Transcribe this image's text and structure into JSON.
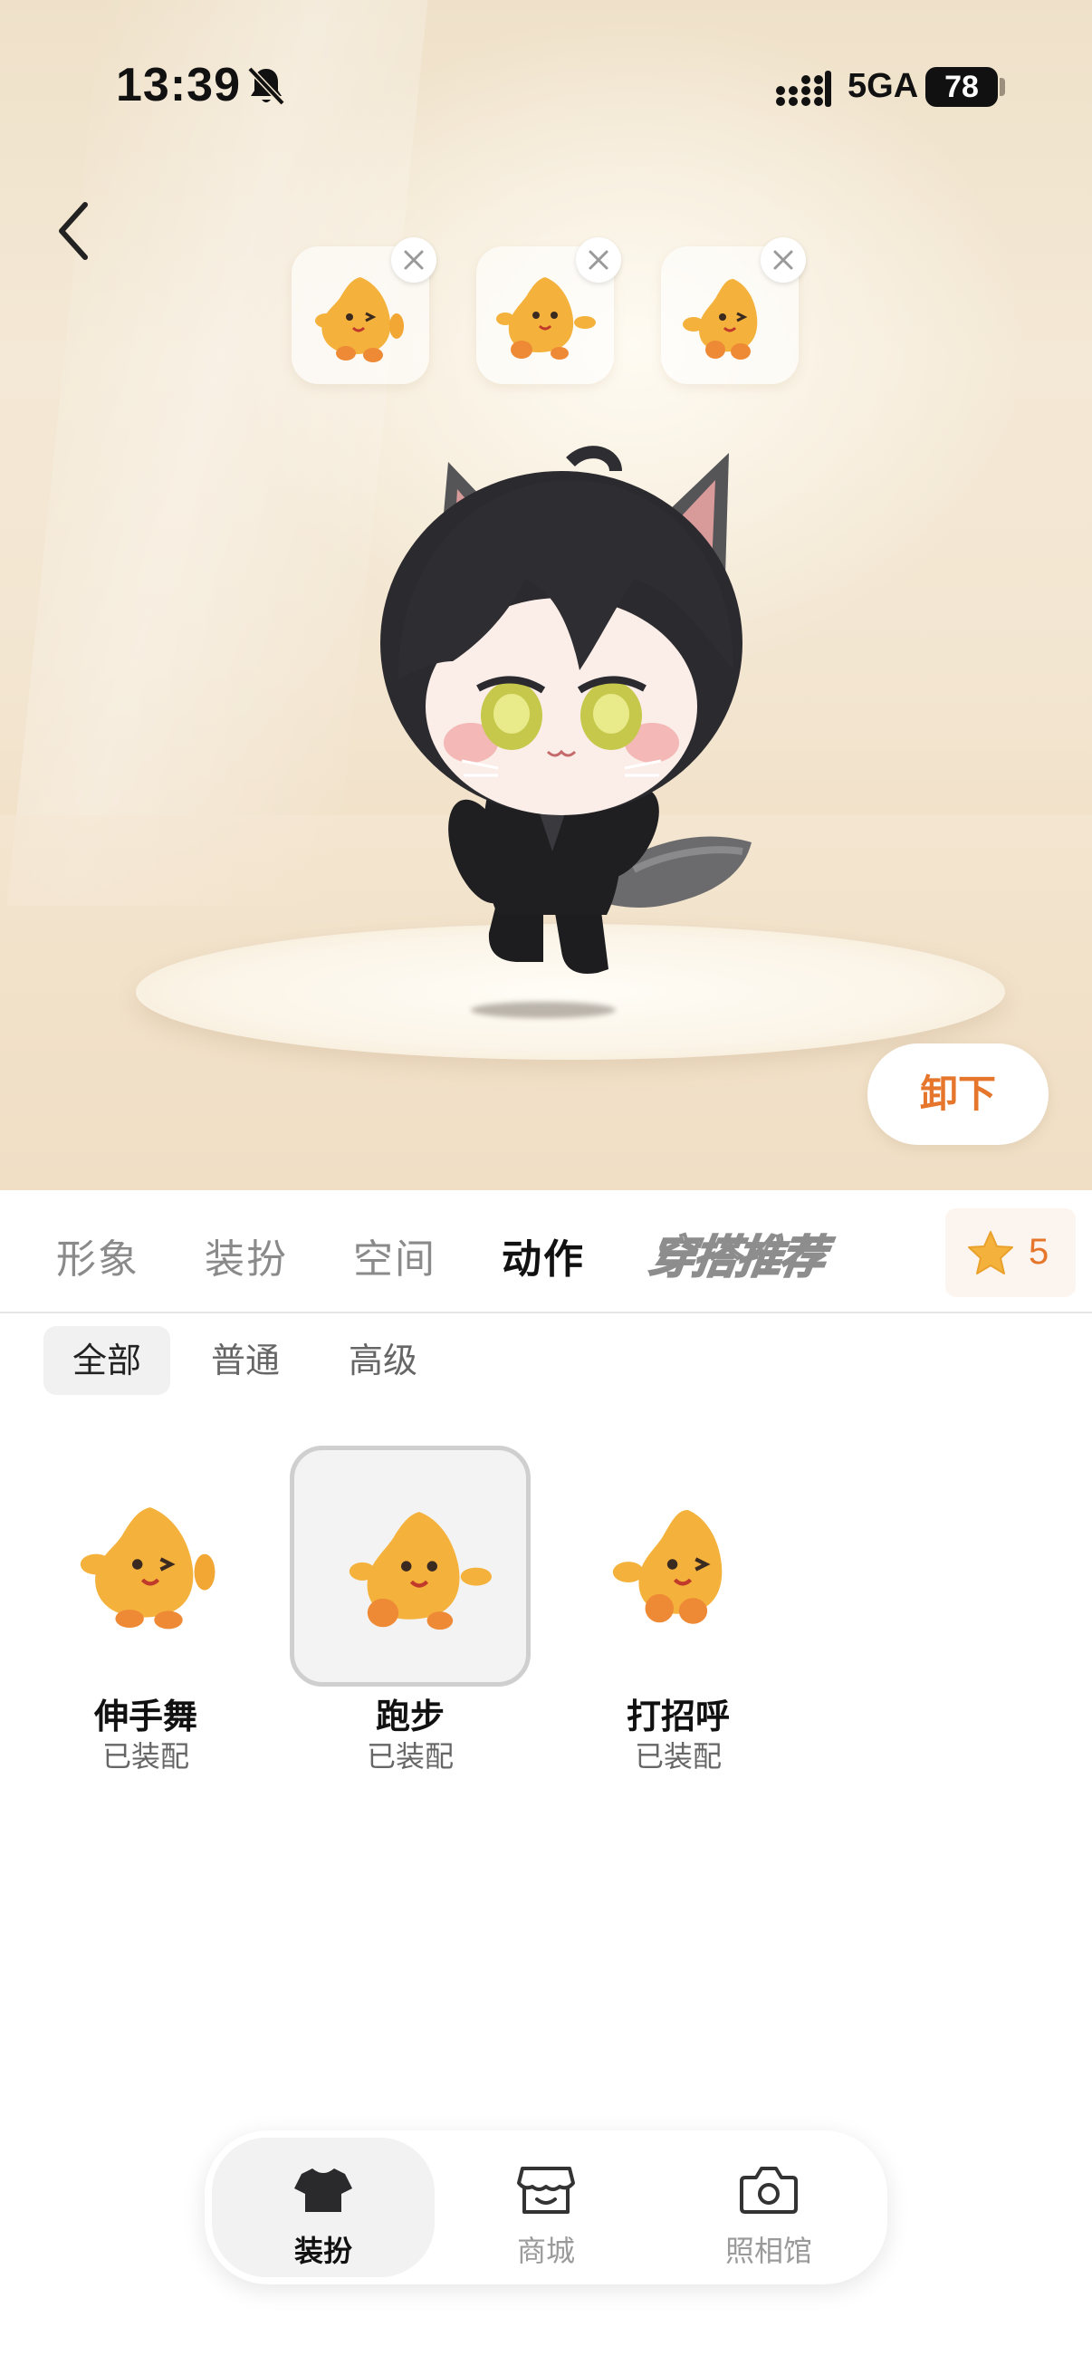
{
  "status_bar": {
    "time": "13:39",
    "network": "5GA",
    "battery": "78"
  },
  "equipped_actions": [
    {
      "icon": "wave-dance-star-icon"
    },
    {
      "icon": "run-star-icon"
    },
    {
      "icon": "greet-star-icon"
    }
  ],
  "stage": {
    "unequip_label": "卸下"
  },
  "tabs": [
    {
      "label": "形象"
    },
    {
      "label": "装扮"
    },
    {
      "label": "空间"
    },
    {
      "label": "动作"
    },
    {
      "label": "穿搭推荐"
    }
  ],
  "active_tab": "动作",
  "star_count": "5",
  "filters": [
    {
      "label": "全部"
    },
    {
      "label": "普通"
    },
    {
      "label": "高级"
    }
  ],
  "actions": [
    {
      "name": "伸手舞",
      "status": "已装配"
    },
    {
      "name": "跑步",
      "status": "已装配"
    },
    {
      "name": "打招呼",
      "status": "已装配"
    }
  ],
  "bottom_nav": [
    {
      "label": "装扮",
      "icon": "shirt-icon"
    },
    {
      "label": "商城",
      "icon": "shop-icon"
    },
    {
      "label": "照相馆",
      "icon": "camera-icon"
    }
  ],
  "colors": {
    "accent": "#e5762b",
    "star": "#f4b23c"
  }
}
